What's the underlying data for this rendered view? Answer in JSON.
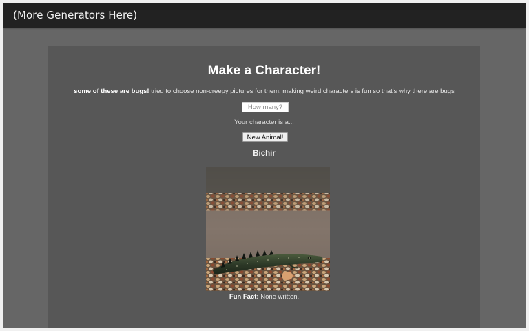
{
  "header": {
    "link_label": "(More Generators Here)"
  },
  "main": {
    "title": "Make a Character!",
    "description_bold": "some of these are bugs!",
    "description_rest": " tried to choose non-creepy pictures for them. making weird characters is fun so that's why there are bugs",
    "count_placeholder": "How many?",
    "count_value": "",
    "result_label": "Your character is a...",
    "new_button_label": "New Animal!",
    "animal_name": "Bichir",
    "fun_fact_label": "Fun Fact:",
    "fun_fact_text": " None written."
  },
  "colors": {
    "header_bg": "#222222",
    "page_bg": "#666666",
    "panel_bg": "#575757"
  }
}
